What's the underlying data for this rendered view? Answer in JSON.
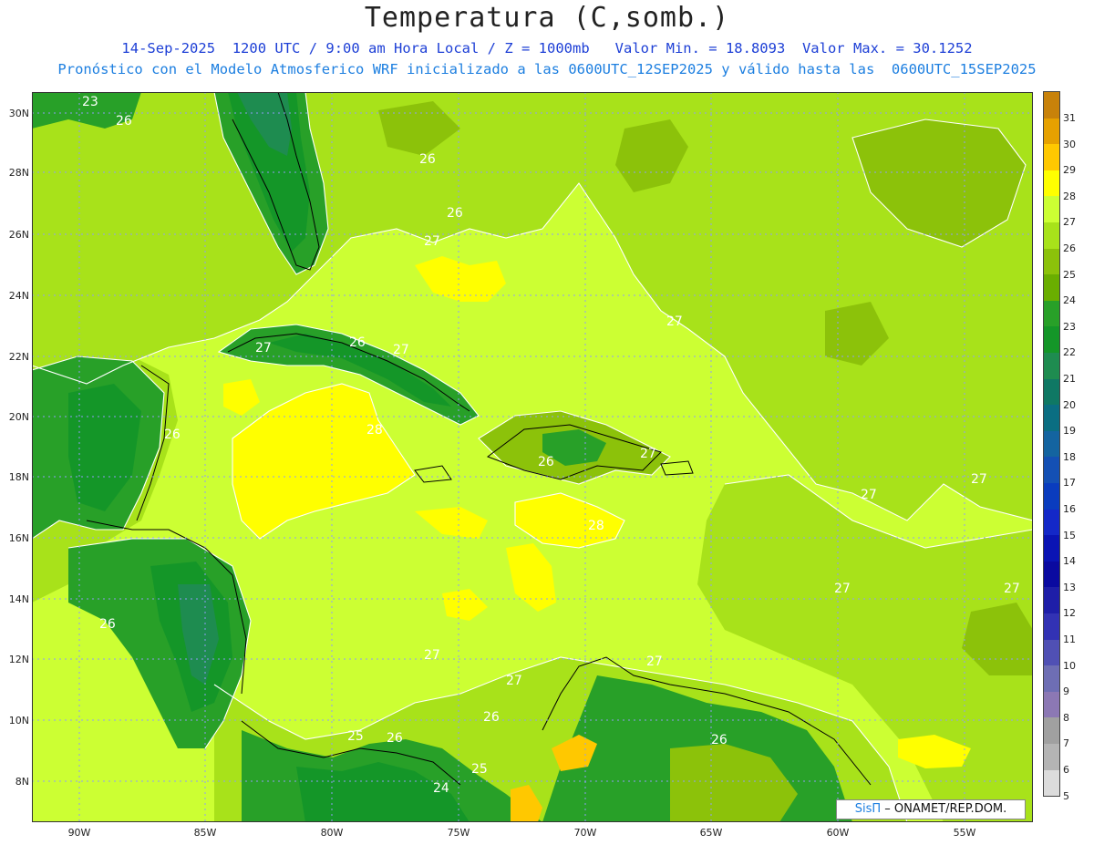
{
  "header": {
    "title": "Temperatura (C,somb.)",
    "subtitle_line1": "14-Sep-2025  1200 UTC / 9:00 am Hora Local / Z = 1000mb   Valor Min. = 18.8093  Valor Max. = 30.1252",
    "subtitle_line2": "Pronóstico con el Modelo Atmosferico WRF inicializado a las 0600UTC_12SEP2025 y válido hasta las  0600UTC_15SEP2025"
  },
  "axes": {
    "lat_labels": [
      "30N",
      "28N",
      "26N",
      "24N",
      "22N",
      "20N",
      "18N",
      "16N",
      "14N",
      "12N",
      "10N",
      "8N"
    ],
    "lon_labels": [
      "90W",
      "85W",
      "80W",
      "75W",
      "70W",
      "65W",
      "60W",
      "55W"
    ]
  },
  "colorbar": {
    "levels": [
      "31",
      "30",
      "29",
      "28",
      "27",
      "26",
      "25",
      "24",
      "23",
      "22",
      "21",
      "20",
      "19",
      "18",
      "17",
      "16",
      "15",
      "14",
      "13",
      "12",
      "11",
      "10",
      "9",
      "8",
      "7",
      "6",
      "5"
    ],
    "colors": [
      "#c8820a",
      "#e6a100",
      "#ffc800",
      "#ffff00",
      "#ccff33",
      "#a8e21a",
      "#8cc20a",
      "#6aae00",
      "#28a028",
      "#149628",
      "#1e8c50",
      "#0f7864",
      "#0a6e82",
      "#1464a0",
      "#1450b4",
      "#0a3cbe",
      "#1428c8",
      "#0a14b4",
      "#0a0aa0",
      "#1e1ea8",
      "#3232b4",
      "#5050b4",
      "#6e6eb4",
      "#8c78b4",
      "#a0a0a0",
      "#b4b4b4",
      "#dcdcdc"
    ]
  },
  "contour_labels": [
    "23",
    "26",
    "26",
    "26",
    "27",
    "27",
    "26",
    "27",
    "27",
    "28",
    "26",
    "27",
    "27",
    "28",
    "27",
    "27",
    "27",
    "27",
    "26",
    "27",
    "26",
    "25",
    "26",
    "24",
    "25",
    "26",
    "26",
    "27"
  ],
  "credit": {
    "sis": "SisΠ",
    "text": "– ONAMET/REP.DOM."
  }
}
